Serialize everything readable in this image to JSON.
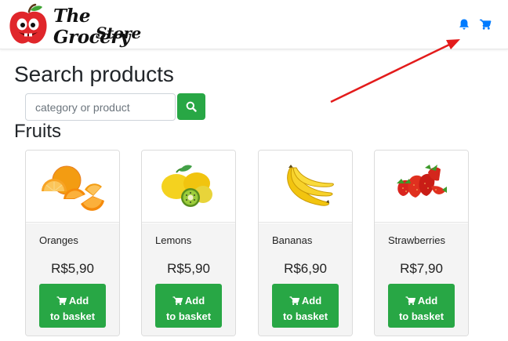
{
  "brand": {
    "line1": "The Grocery",
    "line2": "Store"
  },
  "icons": {
    "logo": "apple-mascot-icon",
    "notifications": "bell-icon",
    "cart": "cart-icon",
    "search": "search-icon",
    "basket": "cart-icon"
  },
  "colors": {
    "accent_green": "#28a745",
    "nav_icon_blue": "#007bff",
    "arrow_red": "#e31b1b"
  },
  "search": {
    "title": "Search products",
    "placeholder": "category or product"
  },
  "section": {
    "title": "Fruits"
  },
  "products": [
    {
      "name": "Oranges",
      "price": "R$5,90",
      "button_line1": "Add",
      "button_line2": "to basket"
    },
    {
      "name": "Lemons",
      "price": "R$5,90",
      "button_line1": "Add",
      "button_line2": "to basket"
    },
    {
      "name": "Bananas",
      "price": "R$6,90",
      "button_line1": "Add",
      "button_line2": "to basket"
    },
    {
      "name": "Strawberries",
      "price": "R$7,90",
      "button_line1": "Add",
      "button_line2": "to basket"
    }
  ]
}
